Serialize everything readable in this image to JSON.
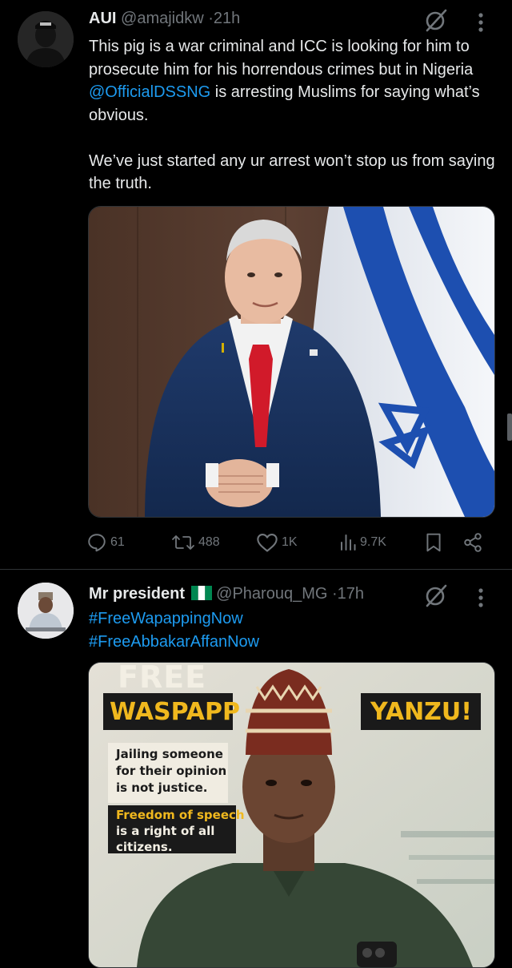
{
  "tweet1": {
    "name": "AUI",
    "handle": "@amajidkw",
    "dot": "·",
    "time": "21h",
    "text_part1": "This pig is a war criminal and ICC is looking for him to prosecute him for his horrendous crimes but in Nigeria ",
    "mention": "@OfficialDSSNG",
    "text_part2": " is arresting Muslims for saying what’s obvious.",
    "text_para2": "We’ve just started any ur arrest won’t stop us from saying the truth.",
    "actions": {
      "replies": "61",
      "reposts": "488",
      "likes": "1K",
      "views": "9.7K"
    }
  },
  "tweet2": {
    "name": "Mr president",
    "flag_emoji": "🇳🇬",
    "handle": "@Pharouq_MG",
    "dot": "·",
    "time": "17h",
    "hashtag1": "#FreeWapappingNow",
    "hashtag2": "#FreeAbbakarAffanNow",
    "poster": {
      "free": "FREE",
      "waspapp": "WASPAPP",
      "yanzu": "YANZU!",
      "line1": "Jailing someone",
      "line2": "for their opinion",
      "line3": "is not justice.",
      "line4": "Freedom of speech",
      "line5": "is a right of all",
      "line6": "citizens."
    }
  },
  "colors": {
    "background": "#000000",
    "text": "#e7e9ea",
    "muted": "#71767b",
    "link": "#1d9bf0",
    "divider": "#2f3336"
  }
}
